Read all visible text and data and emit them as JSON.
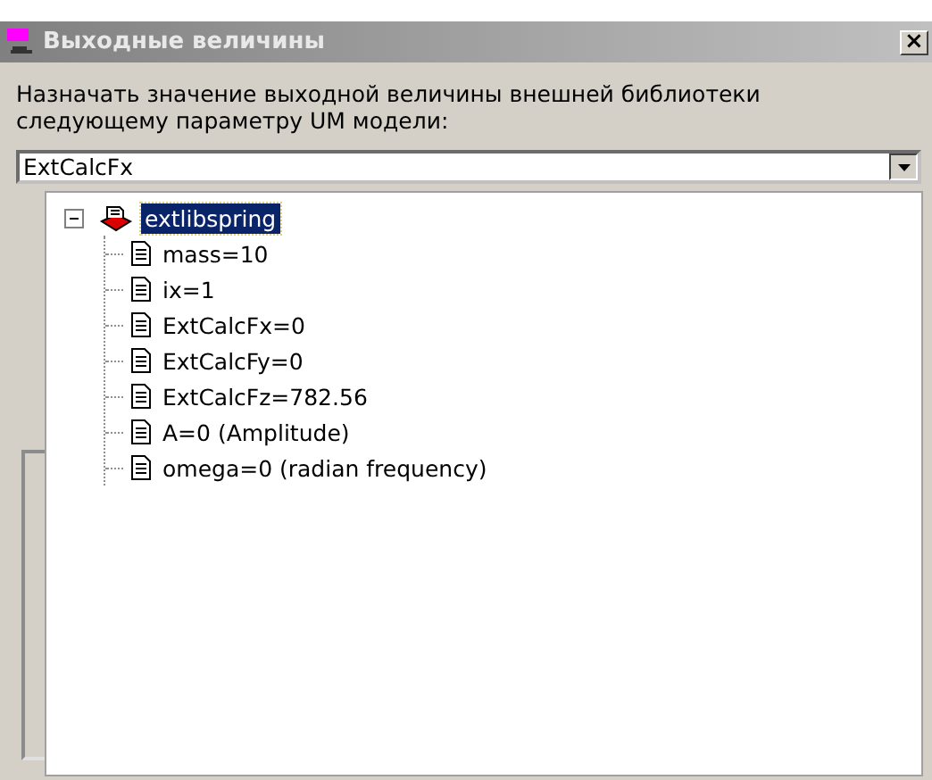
{
  "window": {
    "title": "Выходные величины",
    "close": "×"
  },
  "prompt": "Назначать значение выходной величины внешней библиотеки следующему параметру UM модели:",
  "combo": {
    "value": "ExtCalcFx",
    "expanded": true
  },
  "tree": [
    {
      "label": "extlibspring",
      "expanded": true,
      "selected": true,
      "children": [
        {
          "label": "mass=10",
          "selected": false
        },
        {
          "label": "ix=1",
          "selected": false
        },
        {
          "label": "ExtCalcFx=0",
          "selected": false
        },
        {
          "label": "ExtCalcFy=0",
          "selected": false
        },
        {
          "label": "ExtCalcFz=782.56",
          "selected": false
        },
        {
          "label": "A=0 (Amplitude)",
          "selected": false
        },
        {
          "label": "omega=0 (radian frequency)",
          "selected": false
        }
      ]
    }
  ]
}
